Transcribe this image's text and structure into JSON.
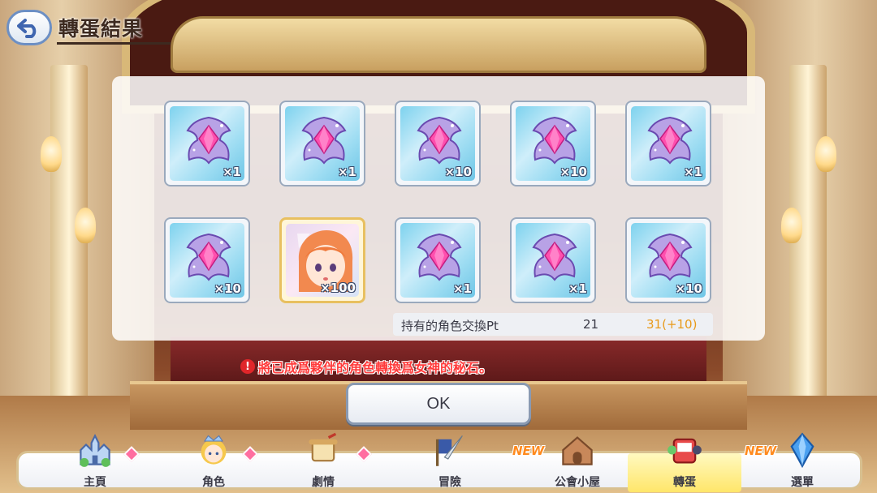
{
  "header": {
    "title": "轉蛋結果"
  },
  "results": [
    {
      "kind": "memory-piece",
      "quantity": "×1"
    },
    {
      "kind": "memory-piece",
      "quantity": "×1"
    },
    {
      "kind": "memory-piece",
      "quantity": "×10"
    },
    {
      "kind": "memory-piece",
      "quantity": "×10"
    },
    {
      "kind": "memory-piece",
      "quantity": "×1"
    },
    {
      "kind": "memory-piece",
      "quantity": "×10"
    },
    {
      "kind": "character",
      "quantity": "×100"
    },
    {
      "kind": "memory-piece",
      "quantity": "×1"
    },
    {
      "kind": "memory-piece",
      "quantity": "×1"
    },
    {
      "kind": "memory-piece",
      "quantity": "×10"
    }
  ],
  "exchange_pt": {
    "label": "持有的角色交換Pt",
    "current": "21",
    "new": "31(+10)"
  },
  "note": {
    "icon": "!",
    "text": "將已成爲夥伴的角色轉換爲女神的秘石。"
  },
  "ok_label": "OK",
  "nav": {
    "items": [
      {
        "label": "主頁",
        "icon": "castle-icon"
      },
      {
        "label": "角色",
        "icon": "princess-icon"
      },
      {
        "label": "劇情",
        "icon": "scroll-icon"
      },
      {
        "label": "冒險",
        "icon": "sword-flag-icon"
      },
      {
        "label": "公會小屋",
        "icon": "house-icon",
        "badge": "NEW"
      },
      {
        "label": "轉蛋",
        "icon": "gacha-icon"
      },
      {
        "label": "選單",
        "icon": "crystal-icon",
        "badge": "NEW"
      }
    ]
  },
  "colors": {
    "accent_orange": "#e89a1a",
    "warning_red": "#ff3b3b",
    "tile_blue": "#7dd2ee"
  }
}
